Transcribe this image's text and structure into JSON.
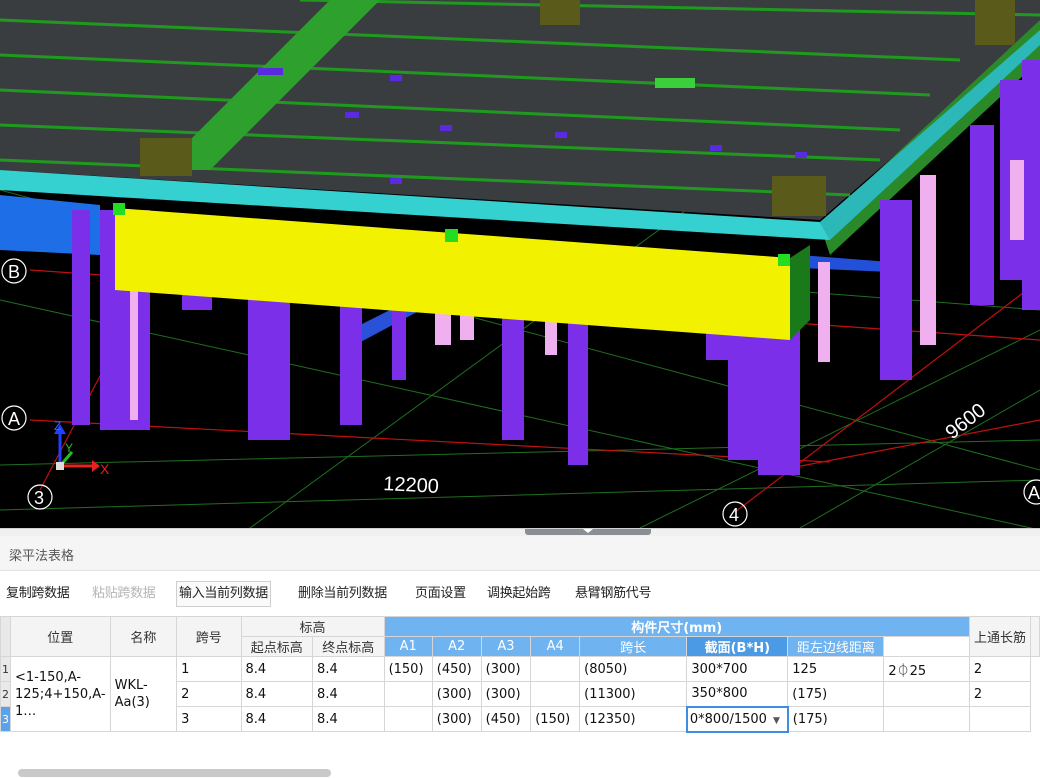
{
  "viewport": {
    "axis_labels": [
      "B",
      "A",
      "3",
      "4",
      "A"
    ],
    "dimensions": [
      "12200",
      "9600"
    ],
    "gizmo": {
      "x": "X",
      "y": "Y",
      "z": "Z"
    }
  },
  "panel": {
    "title": "梁平法表格",
    "toolbar": [
      {
        "label": "复制跨数据",
        "disabled": false
      },
      {
        "label": "粘贴跨数据",
        "disabled": true
      },
      {
        "label": "输入当前列数据",
        "disabled": false
      },
      {
        "label": "删除当前列数据",
        "disabled": false
      },
      {
        "label": "页面设置",
        "disabled": false
      },
      {
        "label": "调换起始跨",
        "disabled": false
      },
      {
        "label": "悬臂钢筋代号",
        "disabled": false
      }
    ]
  },
  "table": {
    "headers": {
      "position": "位置",
      "name": "名称",
      "span_no": "跨号",
      "elevation_group": "标高",
      "start_elev": "起点标高",
      "end_elev": "终点标高",
      "size_group": "构件尺寸(mm)",
      "a1": "A1",
      "a2": "A2",
      "a3": "A3",
      "a4": "A4",
      "span_len": "跨长",
      "section": "截面(B*H)",
      "left_dist": "距左边线距离",
      "top_bar": "上通长筋"
    },
    "merged": {
      "position": "<1-150,A-125;4+150,A-1…",
      "name": "WKL-Aa(3)"
    },
    "rows": [
      {
        "num": "1",
        "span": "1",
        "start": "8.4",
        "end": "8.4",
        "a1": "(150)",
        "a2": "(450)",
        "a3": "(300)",
        "a4": "",
        "len": "(8050)",
        "section": "300*700",
        "left": "125",
        "top": "2⏀25",
        "next": "2"
      },
      {
        "num": "2",
        "span": "2",
        "start": "8.4",
        "end": "8.4",
        "a1": "",
        "a2": "(300)",
        "a3": "(300)",
        "a4": "",
        "len": "(11300)",
        "section": "350*800",
        "left": "(175)",
        "top": "",
        "next": "2"
      },
      {
        "num": "3",
        "span": "3",
        "start": "8.4",
        "end": "8.4",
        "a1": "",
        "a2": "(300)",
        "a3": "(450)",
        "a4": "(150)",
        "len": "(12350)",
        "section": "0*800/1500",
        "left": "(175)",
        "top": "",
        "next": ""
      }
    ]
  }
}
